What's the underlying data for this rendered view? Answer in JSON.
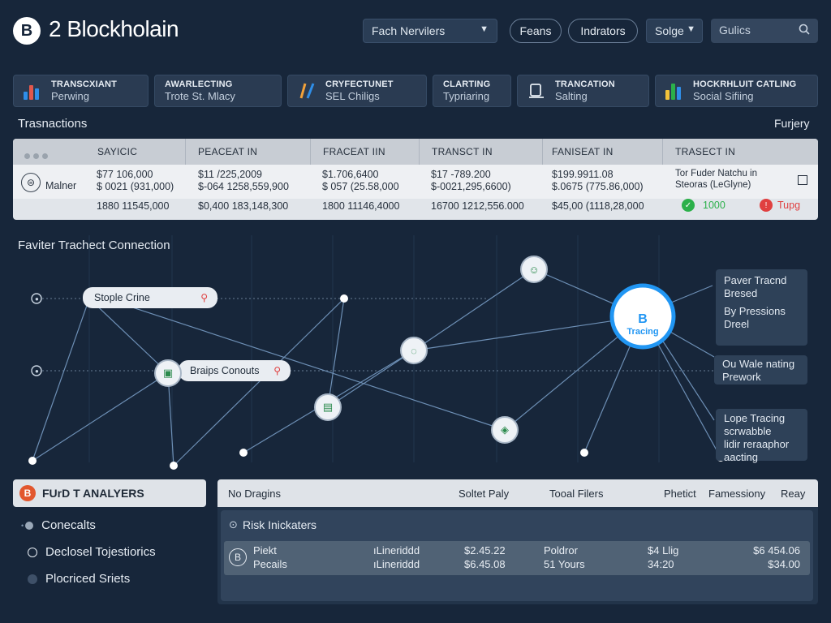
{
  "header": {
    "logo_glyph": "B",
    "title": "2 Blockholain",
    "network_select": "Fach Nervilers",
    "pill1": "Feans",
    "pill2": "Indrators",
    "sort_select": "Solge",
    "search_placeholder": "Gulics"
  },
  "cards": [
    {
      "icon": "bar-chart-icon",
      "line1": "TRANSCXIANT",
      "line2": "Perwing"
    },
    {
      "icon": "none",
      "line1": "AWARLECTING",
      "line2": "Trote St. Mlacy"
    },
    {
      "icon": "slash-chart-icon",
      "line1": "CRYFECTUNET",
      "line2": "SEL Chiligs"
    },
    {
      "icon": "none",
      "line1": "CLARTING",
      "line2": "Typriaring"
    },
    {
      "icon": "transaction-icon",
      "line1": "TRANCATION",
      "line2": "Salting"
    },
    {
      "icon": "bar-chart-icon",
      "line1": "HOCKRHLUIT CATLING",
      "line2": "Social Sifiing"
    }
  ],
  "transactions": {
    "label": "Trasnactions",
    "right_label": "Furjery",
    "columns": [
      "SAYICIC",
      "PEACEAT IN",
      "FRACEAT IIN",
      "TRANSCT IN",
      "FANISEAT IN",
      "TRASECT IN"
    ],
    "row_label": "Malner",
    "rows": [
      [
        "$77 106,000",
        "$11 /225,2009",
        "$1.706,6400",
        "$17 -789.200",
        "$199.9911.08",
        "Tor Fuder Natchu in"
      ],
      [
        "$ 0021 (931,000)",
        "$-064 1258,559,900",
        "$ 057 (25.58,000",
        "$-0021,295,6600)",
        "$.0675 (775.86,000)",
        "Steoras (LeGlyne)"
      ],
      [
        "1880 11545,000",
        "$0,400 183,148,300",
        "1800 11146,4000",
        "16700 1212,556.000",
        "$45,00 (1118,28,000",
        ""
      ]
    ],
    "status_ok": "1000",
    "status_warn": "Tupg"
  },
  "graph": {
    "title": "Faviter Trachect Connection",
    "label_a": "Stople Crine",
    "label_b": "Braips Conouts",
    "center_top": "B",
    "center_bottom": "Tracing",
    "side1_line1": "Paver Tracnd",
    "side1_line2": "Bresed",
    "side2_line1": "By Pressions",
    "side2_line2": "Dreel",
    "side3_line1": "Ou Wale nating",
    "side3_line2": "Prework",
    "side4_line1": "Lope Tracing",
    "side4_line2": "scrwabble",
    "side4_line3": "lidir reraaphor",
    "side4_line4": "aacting"
  },
  "bottom_left": {
    "title": "FUrD T ANALYERS",
    "items": [
      "Conecalts",
      "Declosel Tojestiorics",
      "Plocriced Sriets"
    ]
  },
  "bottom_right": {
    "columns": [
      "No Dragins",
      "Soltet Paly",
      "Tooal Filers",
      "Phetict",
      "Famessiony",
      "Reay"
    ],
    "risk_title": "Risk Inickaters",
    "row": {
      "a1": "Piekt",
      "a2": "Pecails",
      "b1": "Lineriddd",
      "b2": "Lineriddd",
      "c1": "$2.45.22",
      "c2": "$6.45.08",
      "d1": "Poldror",
      "d2": "51 Yours",
      "e1": "$4 Llig",
      "e2": "34:20",
      "f1": "$6 454.06",
      "f2": "$34.00"
    }
  },
  "colors": {
    "accent": "#2196f3",
    "ok": "#2bb04a",
    "warn": "#e04040",
    "bg": "#17263a"
  }
}
